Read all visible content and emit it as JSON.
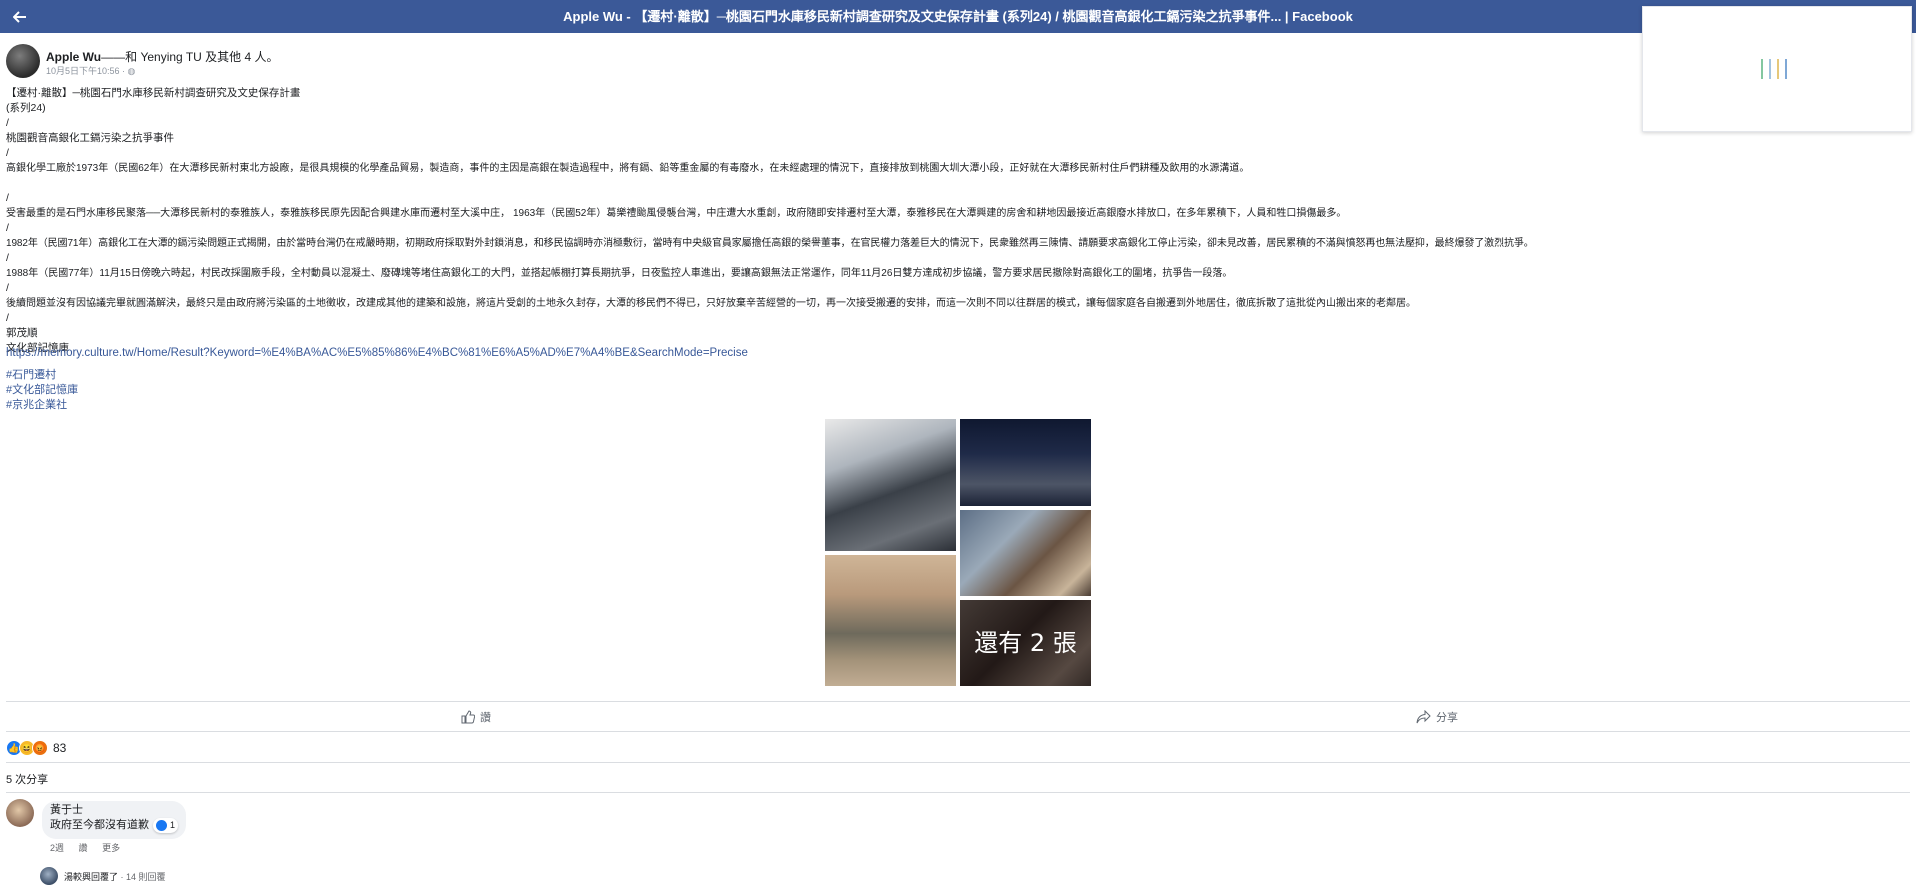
{
  "topbar": {
    "back_icon": "arrow-left-icon",
    "title": "Apple Wu - 【遷村·離散】─桃園石門水庫移民新村調查研究及文史保存計畫 (系列24)  /  桃園觀音高銀化工鎘污染之抗爭事件... | Facebook",
    "bg_color": "#3b5998"
  },
  "loading": {
    "colors": [
      "#84c7a0",
      "#a3c3e0",
      "#e6c87a",
      "#7fa8d6"
    ]
  },
  "post": {
    "author": "Apple Wu",
    "author_rest": "——和 Yenying TU 及其他 4 人。",
    "time": "10月5日下午10:56 · ",
    "lines": [
      "【遷村·離散】─桃園石門水庫移民新村調查研究及文史保存計畫",
      "(系列24)",
      " /",
      "桃園觀音高銀化工鎘污染之抗爭事件",
      "/",
      "高銀化學工廠於1973年（民國62年）在大潭移民新村東北方設廠，是很具規模的化學產品貿易，製造商，事件的主因是高銀在製造過程中，將有鎘、鉛等重金屬的有毒廢水，在未經處理的情況下，直接排放到桃園大圳大潭小段，正好就在大潭移民新村住戶們耕種及飲用的水源溝道。",
      "/",
      "受害最重的是石門水庫移民聚落──大潭移民新村的泰雅族人，泰雅族移民原先因配合興建水庫而遷村至大溪中庄， 1963年（民國52年）葛樂禮颱風侵襲台灣，中庄遭大水重創，政府隨即安排遷村至大潭，泰雅移民在大潭興建的房舍和耕地因最接近高銀廢水排放口，在多年累積下，人員和牲口損傷最多。",
      "/",
      "1982年（民國71年）高銀化工在大潭的鎘污染問題正式揭開，由於當時台灣仍在戒嚴時期，初期政府採取對外封鎖消息，和移民協調時亦消極敷衍，當時有中央級官員家屬擔任高銀的榮譽董事，在官民權力落差巨大的情況下，民衆雖然再三陳情、請願要求高銀化工停止污染，卻未見改善，居民累積的不滿與憤怒再也無法壓抑，最終爆發了激烈抗爭。",
      "/",
      "1988年（民國77年）11月15日傍晚六時起，村民改採圍廠手段，全村動員以混凝土、廢磚塊等堵住高銀化工的大門，並搭起帳棚打算長期抗爭，日夜監控人車進出，要讓高銀無法正常運作，同年11月26日雙方達成初步協議，警方要求居民撤除對高銀化工的圍堵，抗爭告一段落。",
      "/",
      "後續問題並沒有因協議完畢就圓滿解決，最終只是由政府將污染區的土地徵收，改建成其他的建築和設施，將這片受創的土地永久封存，大潭的移民們不得已，只好放棄辛苦經營的一切，再一次接受搬遷的安排，而這一次則不同以往群居的模式，讓每個家庭各自搬遷到外地居住，徹底拆散了這批從內山搬出來的老鄰居。",
      "/",
      "郭茂順",
      "文化部記憶庫"
    ],
    "link": "https://memory.culture.tw/Home/Result?Keyword=%E4%BA%AC%E5%85%86%E4%BC%81%E6%A5%AD%E7%A4%BE&SearchMode=Precise",
    "hashtags": [
      "#石門遷村",
      "#文化部記憶庫",
      "#京兆企業社"
    ],
    "more_photos": "還有 2 張"
  },
  "actions": {
    "like": "讚",
    "share": "分享"
  },
  "stats": {
    "reaction_count": "83",
    "shares": "5 次分享"
  },
  "comment": {
    "name": "黃于士",
    "text": "政府至今都沒有道歉",
    "reaction_count": "1",
    "age": "2週",
    "like": "讚",
    "more": "更多"
  },
  "reply": {
    "who": "湯較興回覆了",
    "count": " · 14 則回覆"
  }
}
